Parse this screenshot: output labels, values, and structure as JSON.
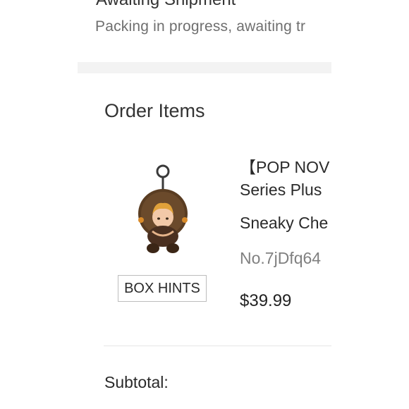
{
  "order_status": {
    "heading_cut": "Awaiting Shipment",
    "detail": "Packing in progress, awaiting tr"
  },
  "order_items": {
    "section_title": "Order Items",
    "items": [
      {
        "image_icon": "plush-keychain-image",
        "box_hints_label": "BOX HINTS",
        "title_line1": "【POP NOV",
        "title_line2": "Series Plus",
        "variant": "Sneaky Che",
        "sku": "No.7jDfq64",
        "price": "$39.99"
      }
    ]
  },
  "summary": {
    "subtotal_label": "Subtotal:"
  },
  "colors": {
    "section_divider": "#f3f3f3",
    "text_primary": "#2a2a2a",
    "text_secondary": "#6f6f6f",
    "sku_gray": "#808080",
    "button_border": "#bdbdbd"
  }
}
